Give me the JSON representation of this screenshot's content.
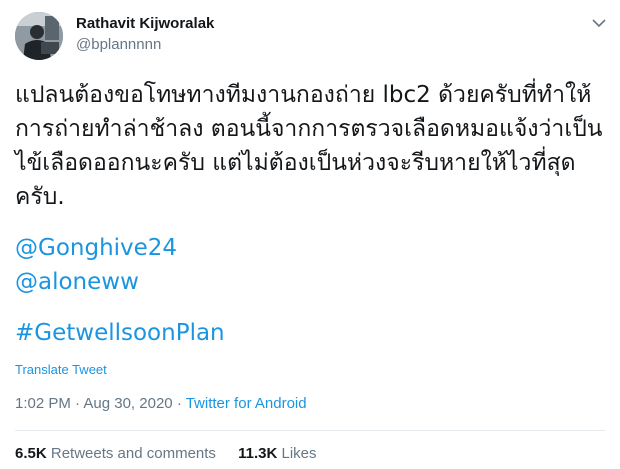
{
  "author": {
    "name": "Rathavit Kijworalak",
    "handle": "@bplannnnn"
  },
  "tweet": {
    "text_lines": [
      "แปลนต้องขอโทษทางทีมงานกองถ่าย lbc2 ด้วยครับที่ทำให้",
      "การถ่ายทำล่าช้าลง ตอนนี้จากการตรวจเลือดหมอแจ้งว่าเป็น",
      "ไข้เลือดออกนะครับ แต่ไม่ต้องเป็นห่วงจะรีบหายให้ไวที่สุด",
      "ครับ."
    ],
    "mentions": [
      "@Gonghive24",
      "@aloneww"
    ],
    "hashtag": "#GetwellsoonPlan"
  },
  "translate_label": "Translate Tweet",
  "meta": {
    "time": "1:02 PM",
    "separator": "·",
    "date": "Aug 30, 2020",
    "source": "Twitter for Android"
  },
  "stats": {
    "retweets_count": "6.5K",
    "retweets_label": "Retweets and comments",
    "likes_count": "11.3K",
    "likes_label": "Likes"
  },
  "icons": {
    "menu": "chevron-down-icon"
  },
  "colors": {
    "link": "#1b95e0",
    "muted": "#657786",
    "text": "#14171a",
    "divider": "#e6ecf0"
  }
}
